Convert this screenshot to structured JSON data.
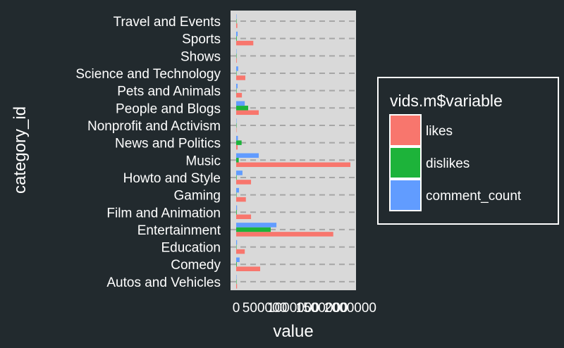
{
  "chart_data": {
    "type": "bar",
    "orientation": "horizontal",
    "title": "",
    "xlabel": "value",
    "ylabel": "category_id",
    "xlim": [
      0,
      2050000
    ],
    "xticks": [
      0,
      500000,
      1000000,
      1500000,
      2000000
    ],
    "xtick_labels": [
      "0",
      "500000",
      "1000000",
      "1500000",
      "2000000"
    ],
    "grid": true,
    "legend_position": "right",
    "legend_title": "vids.m$variable",
    "categories": [
      "Autos and Vehicles",
      "Comedy",
      "Education",
      "Entertainment",
      "Film and Animation",
      "Gaming",
      "Howto and Style",
      "Music",
      "News and Politics",
      "Nonprofit and Activism",
      "People and Blogs",
      "Pets and Animals",
      "Science and Technology",
      "Shows",
      "Sports",
      "Travel and Events"
    ],
    "series": [
      {
        "name": "likes",
        "color": "#f8766d",
        "values": [
          15000,
          420000,
          150000,
          1700000,
          260000,
          170000,
          260000,
          2000000,
          25000,
          3000,
          395000,
          100000,
          160000,
          10000,
          300000,
          20000
        ]
      },
      {
        "name": "dislikes",
        "color": "#1db33a",
        "values": [
          1000,
          10000,
          3000,
          605000,
          10000,
          5000,
          8000,
          45000,
          95000,
          100,
          210000,
          3000,
          5000,
          500,
          10000,
          1000
        ]
      },
      {
        "name": "comment_count",
        "color": "#619cff",
        "values": [
          5000,
          60000,
          15000,
          705000,
          15000,
          50000,
          110000,
          395000,
          30000,
          500,
          150000,
          25000,
          35000,
          1500,
          25000,
          3000
        ]
      }
    ]
  },
  "colors": {
    "background": "#222a2e",
    "panel": "#d9d9d9",
    "grid": "#a6a6a6"
  }
}
